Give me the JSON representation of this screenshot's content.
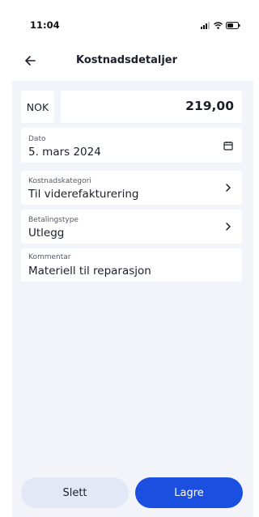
{
  "status_bar": {
    "time": "11:04"
  },
  "header": {
    "title": "Kostnadsdetaljer"
  },
  "amount": {
    "currency": "NOK",
    "value": "219,00"
  },
  "fields": {
    "date": {
      "label": "Dato",
      "value": "5. mars 2024",
      "icon": "calendar-icon"
    },
    "category": {
      "label": "Kostnadskategori",
      "value": "Til viderefakturering",
      "icon": "chevron-right-icon"
    },
    "payment": {
      "label": "Betalingstype",
      "value": "Utlegg",
      "icon": "chevron-right-icon"
    },
    "comment": {
      "label": "Kommentar",
      "value": "Materiell til reparasjon"
    }
  },
  "actions": {
    "delete_label": "Slett",
    "save_label": "Lagre"
  },
  "colors": {
    "primary": "#1a4fe0",
    "secondary": "#e3e8f7",
    "background": "#f2f4f9"
  }
}
